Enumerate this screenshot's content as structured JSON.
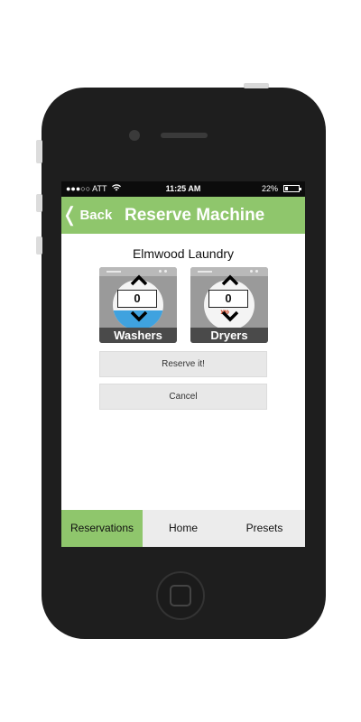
{
  "status_bar": {
    "carrier": "●●●○○ ATT",
    "time": "11:25 AM",
    "battery_percent": "22%",
    "battery_level": 0.22
  },
  "nav": {
    "back_label": "Back",
    "title": "Reserve Machine"
  },
  "location": "Elmwood Laundry",
  "machines": [
    {
      "label": "Washers",
      "count": "0",
      "icon": "washer-icon"
    },
    {
      "label": "Dryers",
      "count": "0",
      "icon": "dryer-icon"
    }
  ],
  "actions": {
    "reserve_label": "Reserve it!",
    "cancel_label": "Cancel"
  },
  "tabs": [
    {
      "label": "Reservations",
      "active": true
    },
    {
      "label": "Home",
      "active": false
    },
    {
      "label": "Presets",
      "active": false
    }
  ],
  "colors": {
    "accent": "#8fc66c",
    "water": "#3fa2df",
    "heat": "#d14b2c"
  }
}
